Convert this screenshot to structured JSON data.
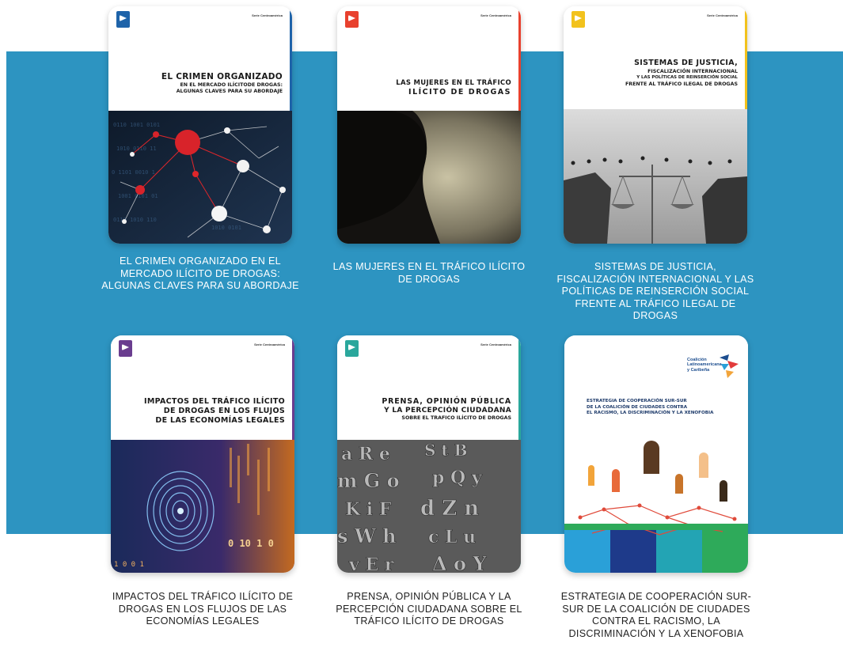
{
  "colors": {
    "band": "#2d94c1",
    "logo_blue": "#1e63a9",
    "logo_red": "#e8412e",
    "logo_yellow": "#f2c21d",
    "logo_purple": "#6a3d8f",
    "logo_teal": "#2aa79c"
  },
  "publications": [
    {
      "caption": "EL CRIMEN ORGANIZADO EN EL MERCADO ILÍCITO DE DROGAS: ALGUNAS CLAVES PARA SU ABORDAJE",
      "cover": {
        "series": "Serie Centroamérica",
        "title_line1": "EL CRIMEN ORGANIZADO",
        "title_line2": "EN EL MERCADO ILÍCITODE DROGAS:",
        "title_line3": "ALGUNAS CLAVES PARA SU ABORDAJE"
      }
    },
    {
      "caption": "LAS MUJERES EN EL TRÁFICO ILÍCITO DE DROGAS",
      "cover": {
        "series": "Serie Centroamérica",
        "title_line1": "LAS MUJERES EN EL TRÁFICO",
        "title_line2": "ILÍCITO DE DROGAS"
      }
    },
    {
      "caption": "SISTEMAS DE JUSTICIA, FISCALIZACIÓN INTERNACIONAL Y LAS POLÍTICAS DE REINSERCIÓN SOCIAL FRENTE AL TRÁFICO ILEGAL DE DROGAS",
      "cover": {
        "series": "Serie Centroamérica",
        "title_line1": "SISTEMAS DE JUSTICIA,",
        "title_line2": "FISCALIZACIÓN INTERNACIONAL",
        "title_line3": "Y LAS POLÍTICAS DE REINSERCIÓN SOCIAL",
        "title_line4": "FRENTE AL TRÁFICO ILEGAL DE DROGAS"
      }
    },
    {
      "caption": "IMPACTOS DEL TRÁFICO ILÍCITO DE DROGAS EN LOS FLUJOS DE LAS ECONOMÍAS LEGALES",
      "cover": {
        "series": "Serie Centroamérica",
        "title_line1": "IMPACTOS DEL TRÁFICO ILÍCITO",
        "title_line2": "DE DROGAS EN LOS FLUJOS",
        "title_line3": "DE LAS ECONOMÍAS LEGALES",
        "digits": "0 10 1 0"
      }
    },
    {
      "caption": "PRENSA, OPINIÓN PÚBLICA Y LA PERCEPCIÓN CIUDADANA SOBRE EL TRÁFICO ILÍCITO DE DROGAS",
      "cover": {
        "series": "Serie Centroamérica",
        "title_line1": "PRENSA, OPINIÓN PÚBLICA",
        "title_line2": "Y LA PERCEPCIÓN CIUDADANA",
        "title_line3": "SOBRE EL TRAFICO ILÍCITO DE DROGAS"
      }
    },
    {
      "caption": "ESTRATEGIA DE COOPERACIÓN SUR-SUR DE LA COALICIÓN DE CIUDADES CONTRA EL RACISMO, LA DISCRIMINACIÓN Y LA XENOFOBIA",
      "cover": {
        "org_line1": "Coalición",
        "org_line2": "Latinoamericana",
        "org_line3": "y Caribeña",
        "title_line1": "ESTRATEGIA DE COOPERACIÓN SUR-SUR",
        "title_line2": "DE LA COALICIÓN DE CIUDADES CONTRA",
        "title_line3": "EL RACISMO, LA DISCRIMINACIÓN Y LA XENOFOBIA"
      }
    }
  ]
}
